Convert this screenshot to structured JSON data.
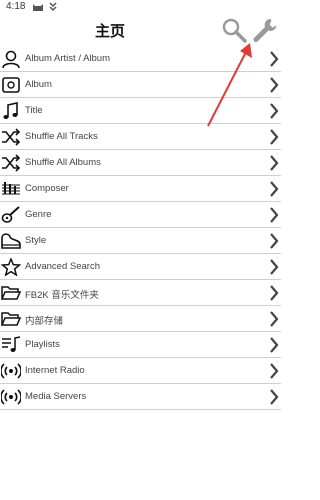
{
  "status": {
    "time": "4:18"
  },
  "header": {
    "title": "主页"
  },
  "menu": [
    {
      "label": "Album Artist / Album",
      "icon": "person-icon"
    },
    {
      "label": "Album",
      "icon": "album-icon"
    },
    {
      "label": "Title",
      "icon": "music-note-icon"
    },
    {
      "label": "Shuffle All Tracks",
      "icon": "shuffle-icon"
    },
    {
      "label": "Shuffle All Albums",
      "icon": "shuffle-icon"
    },
    {
      "label": "Composer",
      "icon": "score-icon"
    },
    {
      "label": "Genre",
      "icon": "guitar-icon"
    },
    {
      "label": "Style",
      "icon": "piano-icon"
    },
    {
      "label": "Advanced Search",
      "icon": "star-icon"
    },
    {
      "label": "FB2K 音乐文件夹",
      "icon": "folder-icon"
    },
    {
      "label": "内部存储",
      "icon": "folder-icon"
    },
    {
      "label": "Playlists",
      "icon": "playlist-icon"
    },
    {
      "label": "Internet Radio",
      "icon": "radio-icon"
    },
    {
      "label": "Media Servers",
      "icon": "radio-icon"
    }
  ],
  "colors": {
    "arrow": "#e53935",
    "divider": "#cfcfcf"
  }
}
